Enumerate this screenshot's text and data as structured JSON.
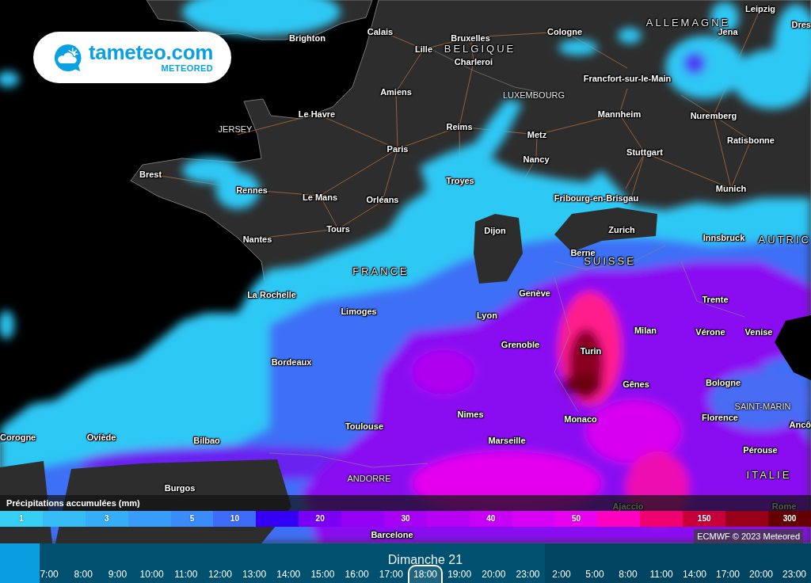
{
  "logo": {
    "name": "tameteo.com",
    "tagline": "METEORED"
  },
  "map": {
    "labels": [
      {
        "text": "Leipzig",
        "kind": "city"
      },
      {
        "text": "ALLEMAGNE",
        "kind": "country"
      },
      {
        "text": "Dres",
        "kind": "city"
      },
      {
        "text": "Calais",
        "kind": "city"
      },
      {
        "text": "Cologne",
        "kind": "city"
      },
      {
        "text": "Jena",
        "kind": "city"
      },
      {
        "text": "Brighton",
        "kind": "city"
      },
      {
        "text": "Bruxelles",
        "kind": "city"
      },
      {
        "text": "Lille",
        "kind": "city"
      },
      {
        "text": "BELGIQUE",
        "kind": "country"
      },
      {
        "text": "Charleroi",
        "kind": "city"
      },
      {
        "text": "Francfort-sur-le-Main",
        "kind": "city"
      },
      {
        "text": "Amiens",
        "kind": "city"
      },
      {
        "text": "LUXEMBOURG",
        "kind": "microstate"
      },
      {
        "text": "Le Havre",
        "kind": "city"
      },
      {
        "text": "Mannheim",
        "kind": "city"
      },
      {
        "text": "Nuremberg",
        "kind": "city"
      },
      {
        "text": "JERSEY",
        "kind": "microstate"
      },
      {
        "text": "Reims",
        "kind": "city"
      },
      {
        "text": "Metz",
        "kind": "city"
      },
      {
        "text": "Ratisbonne",
        "kind": "city"
      },
      {
        "text": "Paris",
        "kind": "city"
      },
      {
        "text": "Stuttgart",
        "kind": "city"
      },
      {
        "text": "Nancy",
        "kind": "city"
      },
      {
        "text": "Brest",
        "kind": "city"
      },
      {
        "text": "Troyes",
        "kind": "city"
      },
      {
        "text": "Rennes",
        "kind": "city"
      },
      {
        "text": "Munich",
        "kind": "city"
      },
      {
        "text": "Le Mans",
        "kind": "city"
      },
      {
        "text": "Orléans",
        "kind": "city"
      },
      {
        "text": "Fribourg-en-Brisgau",
        "kind": "city"
      },
      {
        "text": "Tours",
        "kind": "city"
      },
      {
        "text": "Dijon",
        "kind": "city"
      },
      {
        "text": "Zurich",
        "kind": "city"
      },
      {
        "text": "Nantes",
        "kind": "city"
      },
      {
        "text": "Innsbruck",
        "kind": "city"
      },
      {
        "text": "AUTRIC",
        "kind": "country"
      },
      {
        "text": "Berne",
        "kind": "city"
      },
      {
        "text": "SUISSE",
        "kind": "country"
      },
      {
        "text": "FRANCE",
        "kind": "country"
      },
      {
        "text": "La Rochelle",
        "kind": "city"
      },
      {
        "text": "Genève",
        "kind": "city"
      },
      {
        "text": "Trente",
        "kind": "city"
      },
      {
        "text": "Limoges",
        "kind": "city"
      },
      {
        "text": "Lyon",
        "kind": "city"
      },
      {
        "text": "Milan",
        "kind": "city"
      },
      {
        "text": "Vérone",
        "kind": "city"
      },
      {
        "text": "Venise",
        "kind": "city"
      },
      {
        "text": "Grenoble",
        "kind": "city"
      },
      {
        "text": "Turin",
        "kind": "city"
      },
      {
        "text": "Bordeaux",
        "kind": "city"
      },
      {
        "text": "Gênes",
        "kind": "city"
      },
      {
        "text": "Bologne",
        "kind": "city"
      },
      {
        "text": "SAINT-MARIN",
        "kind": "microstate"
      },
      {
        "text": "Nimes",
        "kind": "city"
      },
      {
        "text": "Monaco",
        "kind": "city"
      },
      {
        "text": "Florence",
        "kind": "city"
      },
      {
        "text": "Toulouse",
        "kind": "city"
      },
      {
        "text": "Ancô",
        "kind": "city"
      },
      {
        "text": "Corogne",
        "kind": "city"
      },
      {
        "text": "Oviède",
        "kind": "city"
      },
      {
        "text": "Bilbao",
        "kind": "city"
      },
      {
        "text": "Marseille",
        "kind": "city"
      },
      {
        "text": "Pérouse",
        "kind": "city"
      },
      {
        "text": "ANDORRE",
        "kind": "microstate"
      },
      {
        "text": "ITALIE",
        "kind": "country"
      },
      {
        "text": "Burgos",
        "kind": "city"
      },
      {
        "text": "Ajaccio",
        "kind": "city"
      },
      {
        "text": "Rome",
        "kind": "city"
      },
      {
        "text": "Barcelone",
        "kind": "city"
      }
    ]
  },
  "legend": {
    "title": "Précipitations accumulées (mm)",
    "steps": [
      {
        "label": "1",
        "color": "#36cff6"
      },
      {
        "color": "#36bdf6"
      },
      {
        "label": "3",
        "color": "#36adf8"
      },
      {
        "color": "#389dfa"
      },
      {
        "label": "5",
        "color": "#3a8cfb"
      },
      {
        "label": "10",
        "color": "#3c6cf9"
      },
      {
        "color": "#3300f5"
      },
      {
        "label": "20",
        "color": "#7a00f5"
      },
      {
        "color": "#9300f5"
      },
      {
        "label": "30",
        "color": "#a600f5"
      },
      {
        "color": "#b800f5"
      },
      {
        "label": "40",
        "color": "#c800f5"
      },
      {
        "color": "#d800f5"
      },
      {
        "label": "50",
        "color": "#e800ef"
      },
      {
        "color": "#ff00c0"
      },
      {
        "color": "#f00070"
      },
      {
        "label": "150",
        "color": "#c8003a"
      },
      {
        "color": "#98001a"
      },
      {
        "label": "300",
        "color": "#640000"
      }
    ]
  },
  "credit": "ECMWF © 2023 Meteored",
  "timeline": {
    "days": [
      {
        "title": "Dimanche 21",
        "times": [
          {
            "label": "7:00",
            "selected": false
          },
          {
            "label": "8:00",
            "selected": false
          },
          {
            "label": "9:00",
            "selected": false
          },
          {
            "label": "10:00",
            "selected": false
          },
          {
            "label": "11:00",
            "selected": false
          },
          {
            "label": "12:00",
            "selected": false
          },
          {
            "label": "13:00",
            "selected": false
          },
          {
            "label": "14:00",
            "selected": false
          },
          {
            "label": "15:00",
            "selected": false
          },
          {
            "label": "16:00",
            "selected": false
          },
          {
            "label": "17:00",
            "selected": false
          },
          {
            "label": "18:00",
            "selected": true
          },
          {
            "label": "19:00",
            "selected": false
          },
          {
            "label": "20:00",
            "selected": false
          },
          {
            "label": "23:00",
            "selected": false
          }
        ]
      },
      {
        "times": [
          {
            "label": "2:00",
            "selected": false
          },
          {
            "label": "5:00",
            "selected": false
          },
          {
            "label": "8:00",
            "selected": false
          },
          {
            "label": "11:00",
            "selected": false
          },
          {
            "label": "14:00",
            "selected": false
          },
          {
            "label": "17:00",
            "selected": false
          },
          {
            "label": "20:00",
            "selected": false
          },
          {
            "label": "23:00",
            "selected": false
          }
        ]
      }
    ]
  }
}
